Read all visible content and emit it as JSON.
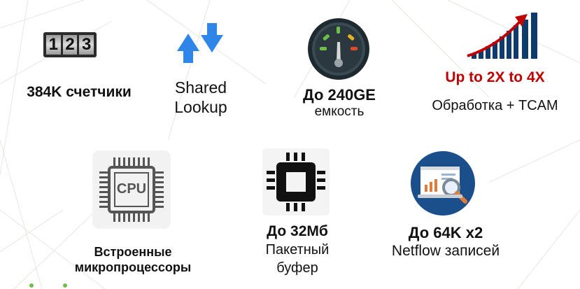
{
  "features": {
    "counters": {
      "title": "384K счетчики"
    },
    "lookup": {
      "line1": "Shared",
      "line2": "Lookup"
    },
    "capacity": {
      "title": "До 240GE",
      "subtitle": "емкость"
    },
    "processing": {
      "title": "Up to 2X to 4X",
      "subtitle": "Обработка + TCAM"
    },
    "cpu": {
      "icon_text": "CPU",
      "line1": "Встроенные",
      "line2": "микропроцессоры"
    },
    "buffer": {
      "title": "До 32Мб",
      "line1": "Пакетный",
      "line2": "буфер"
    },
    "netflow": {
      "title": "До 64K x2",
      "subtitle": "Netflow записей"
    }
  },
  "icons": {
    "counters": "counter-digits-icon",
    "lookup": "sync-arrows-icon",
    "capacity": "gauge-icon",
    "processing": "growth-bar-chart-icon",
    "cpu": "cpu-chip-icon",
    "buffer": "memory-chip-icon",
    "netflow": "magnifier-report-icon"
  },
  "colors": {
    "accent_red": "#c00000",
    "arrow_blue": "#2f86e8",
    "network_lines": "#e3e8df",
    "dots_green": "#6cc04a"
  },
  "counter_digits": [
    "1",
    "2",
    "3"
  ]
}
